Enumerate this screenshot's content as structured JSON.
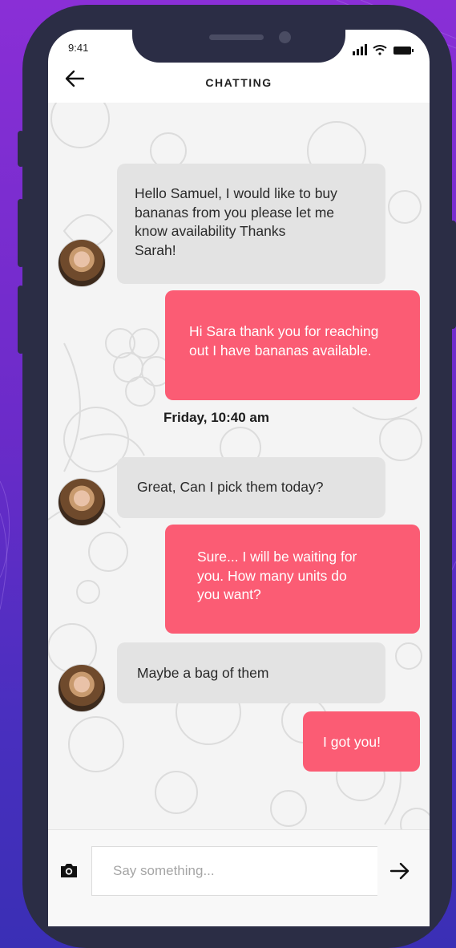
{
  "status_bar": {
    "time": "9:41"
  },
  "header": {
    "title": "CHATTING"
  },
  "messages": [
    {
      "direction": "incoming",
      "text": "Hello Samuel, I would like to buy\nbananas from you please let me\nknow availability Thanks\nSarah!"
    },
    {
      "direction": "outgoing",
      "text": "Hi Sara thank you for reaching\nout I have bananas available."
    },
    {
      "direction": "separator",
      "text": "Friday, 10:40 am"
    },
    {
      "direction": "incoming",
      "text": "Great, Can I pick them today?"
    },
    {
      "direction": "outgoing",
      "text": "Sure... I will be waiting for\nyou. How many units do\nyou want?"
    },
    {
      "direction": "incoming",
      "text": "Maybe a bag of them"
    },
    {
      "direction": "outgoing",
      "text": "I got you!"
    }
  ],
  "composer": {
    "placeholder": "Say something..."
  },
  "icons": {
    "back": "arrow-left-icon",
    "camera": "camera-icon",
    "send": "arrow-right-icon"
  },
  "colors": {
    "outgoing_bubble": "#fb5c74",
    "incoming_bubble": "#e3e3e3",
    "frame": "#2b2d45"
  }
}
